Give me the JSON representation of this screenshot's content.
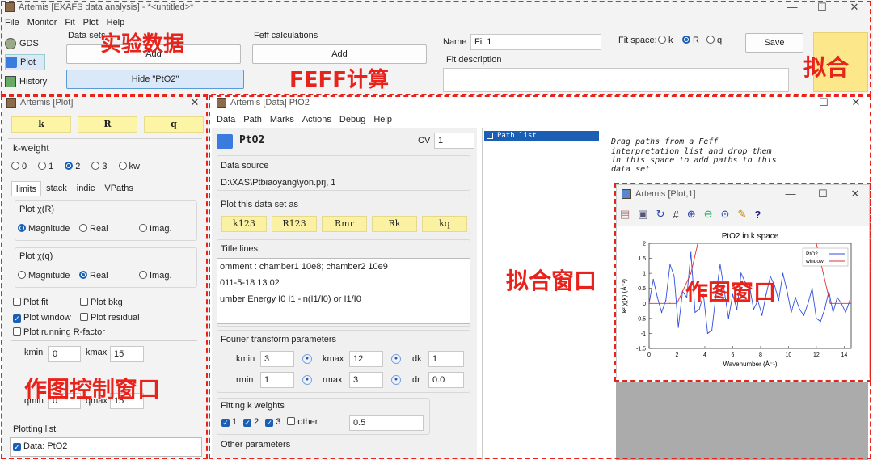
{
  "main": {
    "title": "Artemis [EXAFS data analysis] - *<untitled>*",
    "menu": [
      "File",
      "Monitor",
      "Fit",
      "Plot",
      "Help"
    ],
    "sidebar": [
      "GDS",
      "Plot",
      "History"
    ],
    "data_sets_label": "Data sets",
    "add_label": "Add",
    "hide_label": "Hide \"PtO2\"",
    "feff_label": "Feff calculations",
    "feff_add": "Add",
    "name_label": "Name",
    "name_value": "Fit 1",
    "fit_space_label": "Fit space:",
    "fit_space_options": [
      "k",
      "R",
      "q"
    ],
    "fit_desc_label": "Fit description",
    "save_label": "Save"
  },
  "plotwin": {
    "title": "Artemis [Plot]",
    "space_buttons": [
      "k",
      "R",
      "q"
    ],
    "kweight_label": "k-weight",
    "kweight_options": [
      "0",
      "1",
      "2",
      "3",
      "kw"
    ],
    "tabs": [
      "limits",
      "stack",
      "indic",
      "VPaths"
    ],
    "plot_chir_label": "Plot χ(R)",
    "plot_chiq_label": "Plot χ(q)",
    "part_options": [
      "Magnitude",
      "Real",
      "Imag."
    ],
    "checks": [
      "Plot fit",
      "Plot bkg",
      "Plot window",
      "Plot residual",
      "Plot running R-factor"
    ],
    "kmin_label": "kmin",
    "kmin": "0",
    "kmax_label": "kmax",
    "kmax": "15",
    "qmin_label": "qmin",
    "qmin": "0",
    "qmax_label": "qmax",
    "qmax": "15",
    "plotting_list_label": "Plotting list",
    "plotting_item": "Data: PtO2"
  },
  "datawin": {
    "title": "Artemis [Data] PtO2",
    "menu": [
      "Data",
      "Path",
      "Marks",
      "Actions",
      "Debug",
      "Help"
    ],
    "name": "PtO2",
    "cv_label": "CV",
    "cv_value": "1",
    "source_label": "Data source",
    "source_value": "D:\\XAS\\Ptbiaoyang\\yon.prj, 1",
    "plot_as_label": "Plot this data set as",
    "plot_as": [
      "k123",
      "R123",
      "Rmr",
      "Rk",
      "kq"
    ],
    "title_lines_label": "Title lines",
    "title_lines": [
      "omment :  chamber1  10e8;  chamber2 10e9",
      "011-5-18  13:02",
      "umber Energy    I0          I1              -ln(I1/I0) or I1/I0"
    ],
    "ft_label": "Fourier transform parameters",
    "kmin_label": "kmin",
    "kmin": "3",
    "kmax_label": "kmax",
    "kmax": "12",
    "dk_label": "dk",
    "dk": "1",
    "rmin_label": "rmin",
    "rmin": "1",
    "rmax_label": "rmax",
    "rmax": "3",
    "dr_label": "dr",
    "dr": "0.0",
    "fitk_label": "Fitting k weights",
    "fitk_opts": [
      "1",
      "2",
      "3",
      "other"
    ],
    "other_value": "0.5",
    "other_params_label": "Other parameters",
    "path_list_label": "Path list",
    "drag_text": [
      "Drag paths from a Feff",
      "interpretation list and drop them",
      "in this space to add paths to this",
      "data set"
    ]
  },
  "plot1": {
    "title": "Artemis [Plot,1]",
    "chart_title": "PtO2 in k space",
    "legend": [
      "PtO2",
      "window"
    ],
    "ylabel": "k² χ(k)  (Å⁻²)",
    "xlabel": "Wavenumber  (Å⁻¹)"
  },
  "annotations": {
    "data": "实验数据",
    "feff": "FEFF计算",
    "fit": "拟合",
    "fitwin": "拟合窗口",
    "plotwin": "作图窗口",
    "plotctl": "作图控制窗口"
  },
  "chart_data": {
    "type": "line",
    "title": "PtO2 in k space",
    "xlabel": "Wavenumber (Å⁻¹)",
    "ylabel": "k² χ(k) (Å⁻²)",
    "xlim": [
      0,
      14.5
    ],
    "ylim": [
      -1.5,
      2
    ],
    "xticks": [
      0,
      2,
      4,
      6,
      8,
      10,
      12,
      14
    ],
    "yticks": [
      -1.5,
      -1,
      -0.5,
      0,
      0.5,
      1,
      1.5,
      2
    ],
    "legend_position": "top-right",
    "series": [
      {
        "name": "PtO2",
        "color": "#3050e0",
        "x": [
          0,
          0.3,
          0.6,
          0.9,
          1.2,
          1.5,
          1.8,
          2.1,
          2.4,
          2.7,
          3.0,
          3.3,
          3.6,
          3.9,
          4.2,
          4.5,
          4.8,
          5.1,
          5.4,
          5.7,
          6.0,
          6.3,
          6.6,
          6.9,
          7.2,
          7.5,
          7.8,
          8.1,
          8.4,
          8.7,
          9.0,
          9.3,
          9.6,
          9.9,
          10.2,
          10.5,
          10.8,
          11.1,
          11.4,
          11.7,
          12.0,
          12.3,
          12.6,
          12.9,
          13.2,
          13.5,
          13.8,
          14.1,
          14.4
        ],
        "y": [
          0,
          0.8,
          0.2,
          -0.3,
          0.1,
          1.3,
          0.9,
          -0.8,
          0.4,
          0.2,
          1.7,
          -0.3,
          -0.2,
          0.3,
          -1.0,
          -0.9,
          0.3,
          1.3,
          0.4,
          -0.5,
          0.3,
          -0.2,
          1.0,
          0.7,
          0.6,
          -0.2,
          0.1,
          -0.4,
          0.3,
          0.9,
          0.6,
          0.1,
          1.0,
          0.4,
          -0.3,
          0.2,
          -0.2,
          -0.4,
          0.0,
          0.5,
          -0.5,
          -0.6,
          -0.2,
          0.4,
          -0.3,
          0.2,
          0.0,
          -0.3,
          0.1
        ]
      },
      {
        "name": "window",
        "color": "#e03030",
        "x": [
          0,
          0.5,
          1.5,
          2.0,
          3.0,
          3.5,
          4.0,
          11.5,
          12.0,
          13.0,
          14.5
        ],
        "y": [
          0,
          0,
          0,
          0,
          1.0,
          2.0,
          2.0,
          2.0,
          2.0,
          0,
          0
        ]
      }
    ]
  }
}
